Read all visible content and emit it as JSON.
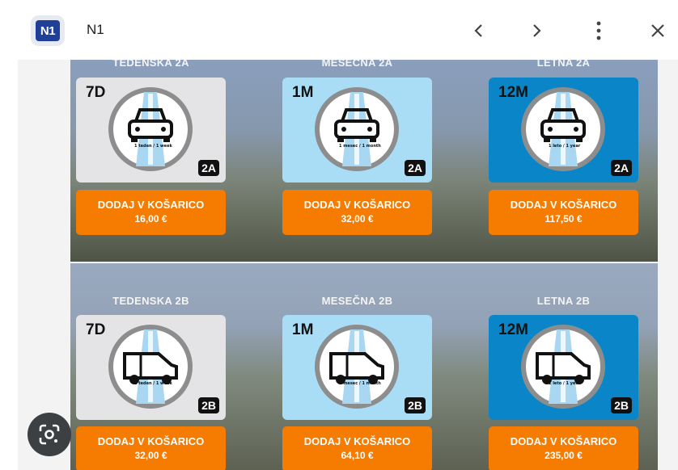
{
  "topbar": {
    "logo_text": "N1",
    "title": "N1",
    "icons": [
      "chevron-left-icon",
      "chevron-right-icon",
      "more-vert-icon",
      "close-icon"
    ]
  },
  "colors": {
    "orange": "#f57c00",
    "card_light": "#e4e4e6",
    "card_sky": "#a9dcf5",
    "card_blue": "#0a86c8",
    "logo_blue": "#1f3f98"
  },
  "sectionA": {
    "titles": [
      "TEDENSKA 2A",
      "MESEČNA 2A",
      "LETNA 2A"
    ],
    "cards": [
      {
        "code": "7D",
        "badge": "2A",
        "small": "1 teden / 1 week",
        "vehicle": "car",
        "style": "light"
      },
      {
        "code": "1M",
        "badge": "2A",
        "small": "1 mesec / 1 month",
        "vehicle": "car",
        "style": "sky"
      },
      {
        "code": "12M",
        "badge": "2A",
        "small": "1 leto / 1 year",
        "vehicle": "car",
        "style": "blue"
      }
    ],
    "buttons": [
      {
        "label": "DODAJ V KOŠARICO",
        "price": "16,00 €"
      },
      {
        "label": "DODAJ V KOŠARICO",
        "price": "32,00 €"
      },
      {
        "label": "DODAJ V KOŠARICO",
        "price": "117,50 €"
      }
    ]
  },
  "sectionB": {
    "titles": [
      "TEDENSKA 2B",
      "MESEČNA 2B",
      "LETNA 2B"
    ],
    "cards": [
      {
        "code": "7D",
        "badge": "2B",
        "small": "1 teden / 1 week",
        "vehicle": "van",
        "style": "light"
      },
      {
        "code": "1M",
        "badge": "2B",
        "small": "1 mesec / 1 month",
        "vehicle": "van",
        "style": "sky"
      },
      {
        "code": "12M",
        "badge": "2B",
        "small": "1 leto / 1 year",
        "vehicle": "van",
        "style": "blue"
      }
    ],
    "buttons": [
      {
        "label": "DODAJ V KOŠARICO",
        "price": "32,00 €"
      },
      {
        "label": "DODAJ V KOŠARICO",
        "price": "64,10 €"
      },
      {
        "label": "DODAJ V KOŠARICO",
        "price": "235,00 €"
      }
    ]
  },
  "lens_icon": "google-lens-icon"
}
